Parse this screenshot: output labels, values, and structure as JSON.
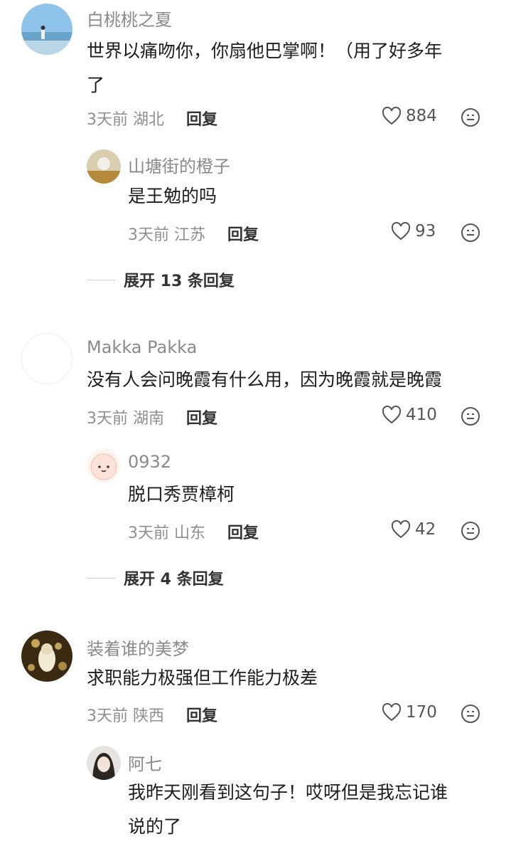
{
  "comments": [
    {
      "author": "白桃桃之夏",
      "text_line1": "世界以痛吻你，你扇他巴掌啊！（用了好多年",
      "text_line2": "了",
      "time": "3天前",
      "location": "湖北",
      "reply_label": "回复",
      "likes": "884",
      "reply": {
        "author": "山塘街的橙子",
        "text": "是王勉的吗",
        "time": "3天前",
        "location": "江苏",
        "reply_label": "回复",
        "likes": "93"
      },
      "expand_label": "展开 13 条回复"
    },
    {
      "author": "Makka Pakka",
      "text_line1": "没有人会问晚霞有什么用，因为晚霞就是晚霞",
      "time": "3天前",
      "location": "湖南",
      "reply_label": "回复",
      "likes": "410",
      "reply": {
        "author": "0932",
        "text": "脱口秀贾樟柯",
        "time": "3天前",
        "location": "山东",
        "reply_label": "回复",
        "likes": "42"
      },
      "expand_label": "展开 4 条回复"
    },
    {
      "author": "装着谁的美梦",
      "text_line1": "求职能力极强但工作能力极差",
      "time": "3天前",
      "location": "陕西",
      "reply_label": "回复",
      "likes": "170",
      "reply": {
        "author": "阿七",
        "text_line1": "我昨天刚看到这句子！哎呀但是我忘记谁",
        "text_line2": "说的了"
      }
    }
  ],
  "icons": {
    "like": "heart-outline-icon",
    "emoji": "smile-face-icon"
  },
  "colors": {
    "name": "#8a8a8a",
    "text": "#1d1d1d",
    "meta": "#8e8e8e",
    "divider": "#cfcfcf"
  }
}
